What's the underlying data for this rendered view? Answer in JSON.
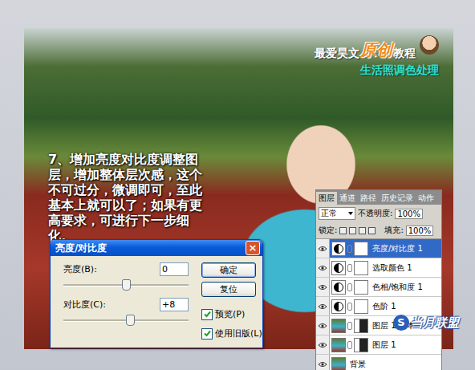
{
  "tutorial": {
    "caption": "7、增加亮度对比度调整图层，增加整体层次感，这个不可过分，微调即可，至此基本上就可以了；如果有更高要求，可进行下一步细化。",
    "logo": {
      "parts": [
        {
          "text": "最爱昊文",
          "accent": false
        },
        {
          "text": "原创",
          "accent": true
        },
        {
          "text": "教程",
          "accent": false
        }
      ],
      "subtitle": "生活照调色处理"
    }
  },
  "dialog": {
    "title": "亮度/对比度",
    "close": "×",
    "fields": [
      {
        "label": "亮度(B):",
        "value": "0",
        "level": 0.5
      },
      {
        "label": "对比度(C):",
        "value": "+8",
        "level": 0.53
      }
    ],
    "buttons": [
      "确定",
      "复位"
    ],
    "checkboxes": [
      {
        "label": "预览(P)",
        "checked": true
      },
      {
        "label": "使用旧版(L)",
        "checked": true
      }
    ]
  },
  "layers_panel": {
    "tabs": [
      {
        "label": "图层",
        "selected": true
      },
      {
        "label": "通道",
        "selected": false
      },
      {
        "label": "路径",
        "selected": false
      },
      {
        "label": "历史记录",
        "selected": false
      },
      {
        "label": "动作",
        "selected": false
      }
    ],
    "blend_mode": "正常",
    "opacity_label": "不透明度:",
    "opacity": "100%",
    "lock_label": "锁定:",
    "fill_label": "填充:",
    "fill": "100%",
    "layers": [
      {
        "name": "亮度/对比度 1",
        "kind": "adjustment",
        "selected": true,
        "visible": true
      },
      {
        "name": "选取颜色 1",
        "kind": "adjustment",
        "selected": false,
        "visible": true
      },
      {
        "name": "色相/饱和度 1",
        "kind": "adjustment",
        "selected": false,
        "visible": true
      },
      {
        "name": "色阶 1",
        "kind": "adjustment",
        "selected": false,
        "visible": true
      },
      {
        "name": "图层 1 副本",
        "kind": "masked",
        "selected": false,
        "visible": true
      },
      {
        "name": "图层 1",
        "kind": "masked",
        "selected": false,
        "visible": true
      },
      {
        "name": "背景",
        "kind": "background",
        "selected": false,
        "visible": true
      }
    ]
  },
  "watermark": {
    "badge": "S",
    "text": "当月联盟"
  }
}
